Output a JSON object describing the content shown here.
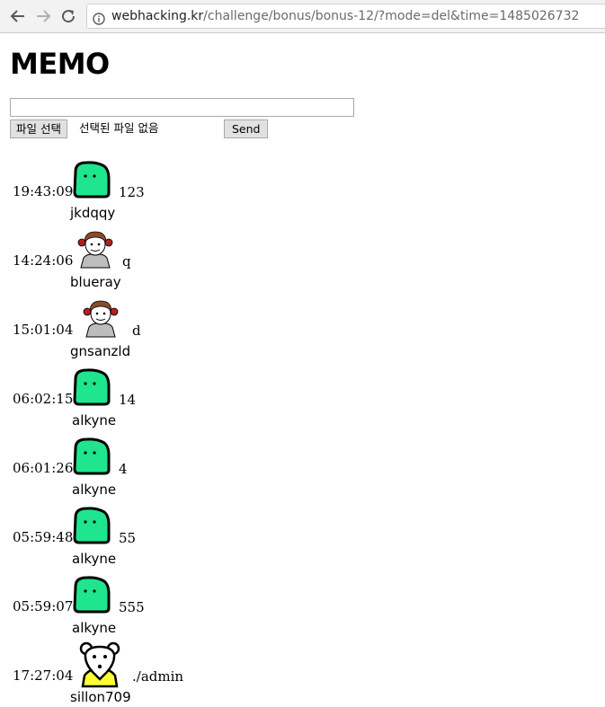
{
  "browser": {
    "url_host": "webhacking.kr",
    "url_path": "/challenge/bonus/bonus-12/?mode=del&time=1485026732",
    "icons": [
      "back-arrow-icon",
      "forward-arrow-icon",
      "reload-icon",
      "info-icon"
    ]
  },
  "page": {
    "title": "MEMO",
    "memo_input_value": "",
    "file_button_label": "파일 선택",
    "file_status": "선택된 파일 없음",
    "send_label": "Send"
  },
  "entries": [
    {
      "time": "19:43:09",
      "avatar": "green-blob-avatar",
      "message": "123",
      "user": "jkdqqy"
    },
    {
      "time": "14:24:06",
      "avatar": "girl-avatar",
      "message": "q",
      "user": "blueray"
    },
    {
      "time": "15:01:04",
      "avatar": "girl-avatar",
      "message": "d",
      "user": "gnsanzld"
    },
    {
      "time": "06:02:15",
      "avatar": "green-blob-avatar",
      "message": "14",
      "user": "alkyne"
    },
    {
      "time": "06:01:26",
      "avatar": "green-blob-avatar",
      "message": "4",
      "user": "alkyne"
    },
    {
      "time": "05:59:48",
      "avatar": "green-blob-avatar",
      "message": "55",
      "user": "alkyne"
    },
    {
      "time": "05:59:07",
      "avatar": "green-blob-avatar",
      "message": "555",
      "user": "alkyne"
    },
    {
      "time": "17:27:04",
      "avatar": "mouse-avatar",
      "message": "./admin",
      "user": "sillon709"
    }
  ],
  "colors": {
    "blob_green": "#1ee58e",
    "mouse_yellow": "#ffff33",
    "hair_brown": "#8b4a2b"
  }
}
